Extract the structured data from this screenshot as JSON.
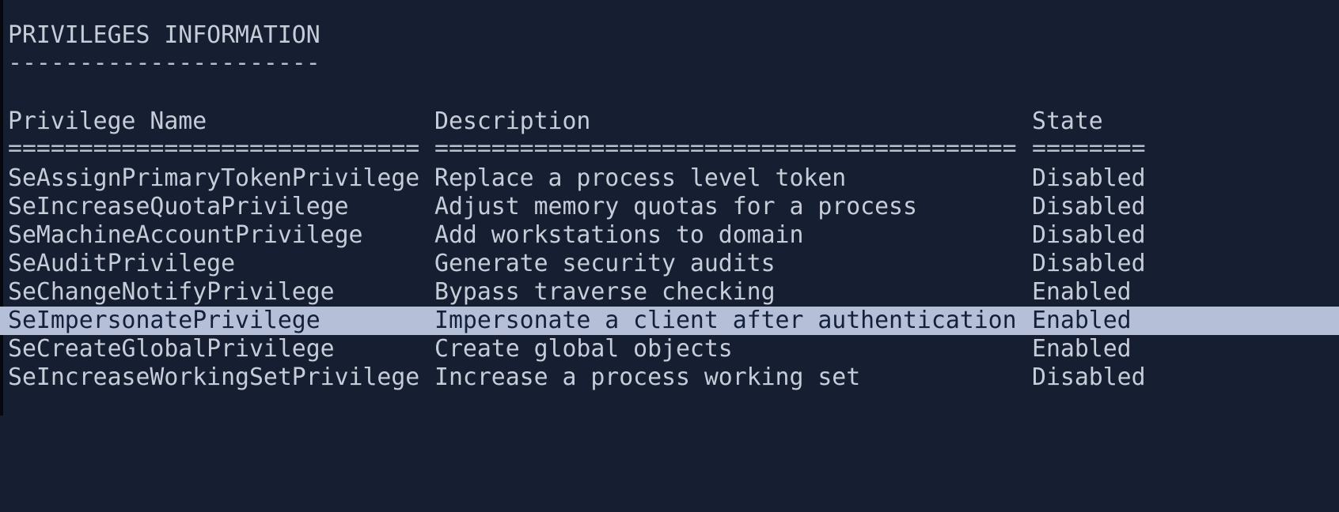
{
  "section": {
    "title": "PRIVILEGES INFORMATION",
    "underline": "----------------------"
  },
  "table": {
    "headers": {
      "name": "Privilege Name",
      "description": "Description",
      "state": "State"
    },
    "separators": {
      "name": "=============================",
      "description": "=========================================",
      "state": "========"
    },
    "rows": [
      {
        "name": "SeAssignPrimaryTokenPrivilege",
        "description": "Replace a process level token",
        "state": "Disabled"
      },
      {
        "name": "SeIncreaseQuotaPrivilege",
        "description": "Adjust memory quotas for a process",
        "state": "Disabled"
      },
      {
        "name": "SeMachineAccountPrivilege",
        "description": "Add workstations to domain",
        "state": "Disabled"
      },
      {
        "name": "SeAuditPrivilege",
        "description": "Generate security audits",
        "state": "Disabled"
      },
      {
        "name": "SeChangeNotifyPrivilege",
        "description": "Bypass traverse checking",
        "state": "Enabled"
      },
      {
        "name": "SeImpersonatePrivilege",
        "description": "Impersonate a client after authentication",
        "state": "Enabled"
      },
      {
        "name": "SeCreateGlobalPrivilege",
        "description": "Create global objects",
        "state": "Enabled"
      },
      {
        "name": "SeIncreaseWorkingSetPrivilege",
        "description": "Increase a process working set",
        "state": "Disabled"
      }
    ],
    "selected_row": "SeImpersonatePrivilege"
  },
  "colors": {
    "background": "#151f31",
    "text": "#c6ccd8",
    "selection": "#b5bfd8"
  }
}
